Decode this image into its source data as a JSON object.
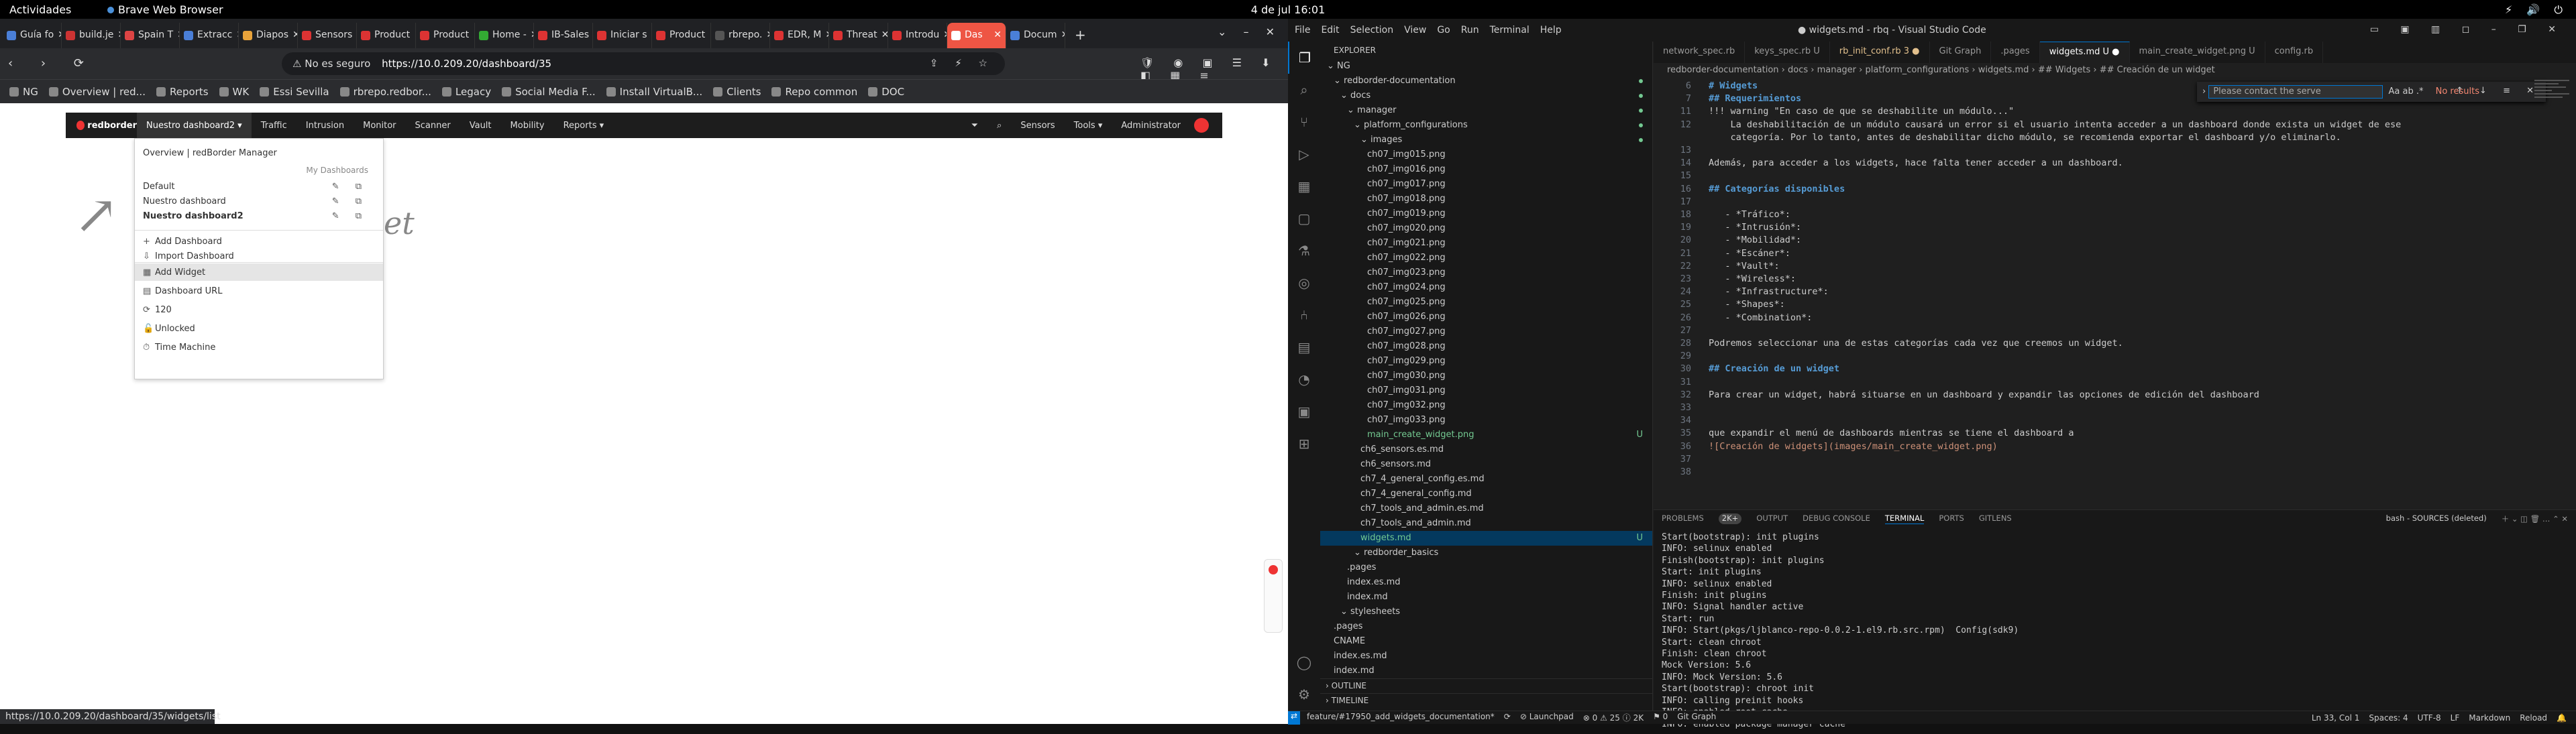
{
  "gnome": {
    "activities": "Actividades",
    "app": "Brave Web Browser",
    "clock": "4 de jul 16:01"
  },
  "brave": {
    "tabs": [
      {
        "label": "Guía fo",
        "color": "#4a7fd8"
      },
      {
        "label": "build.je",
        "color": "#c33"
      },
      {
        "label": "Spain T",
        "color": "#d44"
      },
      {
        "label": "Extracc",
        "color": "#4a7fd8"
      },
      {
        "label": "Diapos",
        "color": "#e9a33b"
      },
      {
        "label": "Sensors",
        "color": "#d33"
      },
      {
        "label": "Product",
        "color": "#d33"
      },
      {
        "label": "Product",
        "color": "#d33"
      },
      {
        "label": "Home -",
        "color": "#3a3"
      },
      {
        "label": "IB-Sales",
        "color": "#d33"
      },
      {
        "label": "Iniciar s",
        "color": "#d33"
      },
      {
        "label": "Product",
        "color": "#d33"
      },
      {
        "label": "rbrepo.",
        "color": "#555"
      },
      {
        "label": "EDR, M",
        "color": "#d33"
      },
      {
        "label": "Threat",
        "color": "#d33"
      },
      {
        "label": "Introdu",
        "color": "#d33"
      },
      {
        "label": "Das",
        "color": "#fff"
      },
      {
        "label": "Docum",
        "color": "#4a7fd8"
      }
    ],
    "active_tab": 16,
    "insecure": "No es seguro",
    "url": "https://10.0.209.20/dashboard/35",
    "bookmarks": [
      "NG",
      "Overview | red...",
      "Reports",
      "WK",
      "Essi Sevilla",
      "rbrepo.redbor...",
      "Legacy",
      "Social Media F...",
      "Install VirtualB...",
      "Clients",
      "Repo common",
      "DOC"
    ],
    "status_url": "https://10.0.209.20/dashboard/35/widgets/list"
  },
  "rb": {
    "logo": "redborder",
    "dashboard_menu": "Nuestro dashboard2",
    "nav": [
      "Traffic",
      "Intrusion",
      "Monitor",
      "Scanner",
      "Vault",
      "Mobility",
      "Reports"
    ],
    "right": [
      "Sensors",
      "Tools",
      "Administrator"
    ],
    "dropdown": {
      "overview": "Overview | redBorder Manager",
      "my_dashboards": "My Dashboards",
      "dashboards": [
        "Default",
        "Nuestro dashboard",
        "Nuestro dashboard2"
      ],
      "actions1": [
        "Add Dashboard",
        "Import Dashboard"
      ],
      "actions2": [
        "Add Widget",
        "Dashboard URL",
        "120",
        "Unlocked",
        "Time Machine"
      ]
    },
    "bg_text": "et"
  },
  "vscode": {
    "menu": [
      "File",
      "Edit",
      "Selection",
      "View",
      "Go",
      "Run",
      "Terminal",
      "Help"
    ],
    "title": "● widgets.md - rbq - Visual Studio Code",
    "explorer": "EXPLORER",
    "tree": [
      {
        "t": "NG",
        "d": 0,
        "k": "f"
      },
      {
        "t": "redborder-documentation",
        "d": 1,
        "k": "f",
        "m": 1
      },
      {
        "t": "docs",
        "d": 2,
        "k": "f",
        "m": 1
      },
      {
        "t": "manager",
        "d": 3,
        "k": "f",
        "m": 1
      },
      {
        "t": "platform_configurations",
        "d": 4,
        "k": "f",
        "m": 1
      },
      {
        "t": "images",
        "d": 5,
        "k": "f",
        "m": 1
      },
      {
        "t": "ch07_img015.png",
        "d": 6
      },
      {
        "t": "ch07_img016.png",
        "d": 6
      },
      {
        "t": "ch07_img017.png",
        "d": 6
      },
      {
        "t": "ch07_img018.png",
        "d": 6
      },
      {
        "t": "ch07_img019.png",
        "d": 6
      },
      {
        "t": "ch07_img020.png",
        "d": 6
      },
      {
        "t": "ch07_img021.png",
        "d": 6
      },
      {
        "t": "ch07_img022.png",
        "d": 6
      },
      {
        "t": "ch07_img023.png",
        "d": 6
      },
      {
        "t": "ch07_img024.png",
        "d": 6
      },
      {
        "t": "ch07_img025.png",
        "d": 6
      },
      {
        "t": "ch07_img026.png",
        "d": 6
      },
      {
        "t": "ch07_img027.png",
        "d": 6
      },
      {
        "t": "ch07_img028.png",
        "d": 6
      },
      {
        "t": "ch07_img029.png",
        "d": 6
      },
      {
        "t": "ch07_img030.png",
        "d": 6
      },
      {
        "t": "ch07_img031.png",
        "d": 6
      },
      {
        "t": "ch07_img032.png",
        "d": 6
      },
      {
        "t": "ch07_img033.png",
        "d": 6
      },
      {
        "t": "main_create_widget.png",
        "d": 6,
        "u": "U"
      },
      {
        "t": "ch6_sensors.es.md",
        "d": 5
      },
      {
        "t": "ch6_sensors.md",
        "d": 5
      },
      {
        "t": "ch7_4_general_config.es.md",
        "d": 5
      },
      {
        "t": "ch7_4_general_config.md",
        "d": 5
      },
      {
        "t": "ch7_tools_and_admin.es.md",
        "d": 5
      },
      {
        "t": "ch7_tools_and_admin.md",
        "d": 5
      },
      {
        "t": "widgets.md",
        "d": 5,
        "u": "U",
        "sel": 1
      },
      {
        "t": "redborder_basics",
        "d": 4,
        "k": "f"
      },
      {
        "t": ".pages",
        "d": 3
      },
      {
        "t": "index.es.md",
        "d": 3
      },
      {
        "t": "index.md",
        "d": 3
      },
      {
        "t": "stylesheets",
        "d": 2,
        "k": "f"
      },
      {
        "t": ".pages",
        "d": 1
      },
      {
        "t": "CNAME",
        "d": 1
      },
      {
        "t": "index.es.md",
        "d": 1
      },
      {
        "t": "index.md",
        "d": 1
      }
    ],
    "outline": "OUTLINE",
    "timeline": "TIMELINE",
    "editor_tabs": [
      {
        "t": "network_spec.rb"
      },
      {
        "t": "keys_spec.rb U"
      },
      {
        "t": "rb_init_conf.rb 3 ●",
        "mod": 1
      },
      {
        "t": "Git Graph"
      },
      {
        "t": ".pages"
      },
      {
        "t": "widgets.md U ●",
        "on": 1
      },
      {
        "t": "main_create_widget.png U"
      },
      {
        "t": "config.rb"
      }
    ],
    "breadcrumb": "redborder-documentation › docs › manager › platform_configurations › widgets.md › ## Widgets › ## Creación de un widget",
    "find": {
      "value": "Please contact the serve",
      "result": "No results"
    },
    "code": [
      {
        "n": "6",
        "t": "# Widgets",
        "c": "h"
      },
      {
        "n": "7",
        "t": "## Requerimientos",
        "c": "h"
      },
      {
        "n": "11",
        "t": "!!! warning \"En caso de que se deshabilite un módulo...\""
      },
      {
        "n": "12",
        "t": "    La deshabilitación de un módulo causará un error si el usuario intenta acceder a un dashboard donde exista un widget de ese"
      },
      {
        "n": "",
        "t": "    categoría. Por lo tanto, antes de deshabilitar dicho módulo, se recomienda exportar el dashboard y/o eliminarlo."
      },
      {
        "n": "13",
        "t": ""
      },
      {
        "n": "14",
        "t": "Además, para acceder a los widgets, hace falta tener acceder a un dashboard."
      },
      {
        "n": "15",
        "t": ""
      },
      {
        "n": "16",
        "t": "## Categorías disponibles",
        "c": "h"
      },
      {
        "n": "17",
        "t": ""
      },
      {
        "n": "18",
        "t": "   - *Tráfico*:"
      },
      {
        "n": "19",
        "t": "   - *Intrusión*:"
      },
      {
        "n": "20",
        "t": "   - *Mobilidad*:"
      },
      {
        "n": "21",
        "t": "   - *Escáner*:"
      },
      {
        "n": "22",
        "t": "   - *Vault*:"
      },
      {
        "n": "23",
        "t": "   - *Wireless*:"
      },
      {
        "n": "24",
        "t": "   - *Infrastructure*:"
      },
      {
        "n": "25",
        "t": "   - *Shapes*:"
      },
      {
        "n": "26",
        "t": "   - *Combination*:"
      },
      {
        "n": "27",
        "t": ""
      },
      {
        "n": "28",
        "t": "Podremos seleccionar una de estas categorías cada vez que creemos un widget."
      },
      {
        "n": "29",
        "t": ""
      },
      {
        "n": "30",
        "t": "## Creación de un widget",
        "c": "h"
      },
      {
        "n": "31",
        "t": ""
      },
      {
        "n": "32",
        "t": "Para crear un widget, habrá situarse en un dashboard y expandir las opciones de edición del dashboard"
      },
      {
        "n": "33",
        "t": ""
      },
      {
        "n": "34",
        "t": ""
      },
      {
        "n": "35",
        "t": "que expandir el menú de dashboards mientras se tiene el dashboard a"
      },
      {
        "n": "36",
        "t": "![Creación de widgets](images/main_create_widget.png)",
        "c": "lk"
      },
      {
        "n": "37",
        "t": ""
      },
      {
        "n": "38",
        "t": ""
      }
    ],
    "panel_tabs": [
      "PROBLEMS",
      "OUTPUT",
      "DEBUG CONSOLE",
      "TERMINAL",
      "PORTS",
      "GITLENS"
    ],
    "problems_count": "2K+",
    "active_panel": 3,
    "shell": "bash - SOURCES (deleted)",
    "terminal": [
      "Start(bootstrap): init plugins",
      "INFO: selinux enabled",
      "Finish(bootstrap): init plugins",
      "Start: init plugins",
      "INFO: selinux enabled",
      "Finish: init plugins",
      "INFO: Signal handler active",
      "Start: run",
      "INFO: Start(pkgs/ljblanco-repo-0.0.2-1.el9.rb.src.rpm)  Config(sdk9)",
      "Start: clean chroot",
      "Finish: clean chroot",
      "Mock Version: 5.6",
      "INFO: Mock Version: 5.6",
      "Start(bootstrap): chroot init",
      "INFO: calling preinit hooks",
      "INFO: enabled root cache",
      "INFO: enabled package manager cache"
    ],
    "status_left": [
      "feature/#17950_add_widgets_documentation*",
      "⟳",
      "⊘ Launchpad",
      "⊗ 0 ⚠ 25 ⓘ 2K",
      "⚑ 0",
      "Git Graph"
    ],
    "status_right": [
      "Ln 33, Col 1",
      "Spaces: 4",
      "UTF-8",
      "LF",
      "Markdown",
      "Reload",
      "🔔"
    ]
  }
}
